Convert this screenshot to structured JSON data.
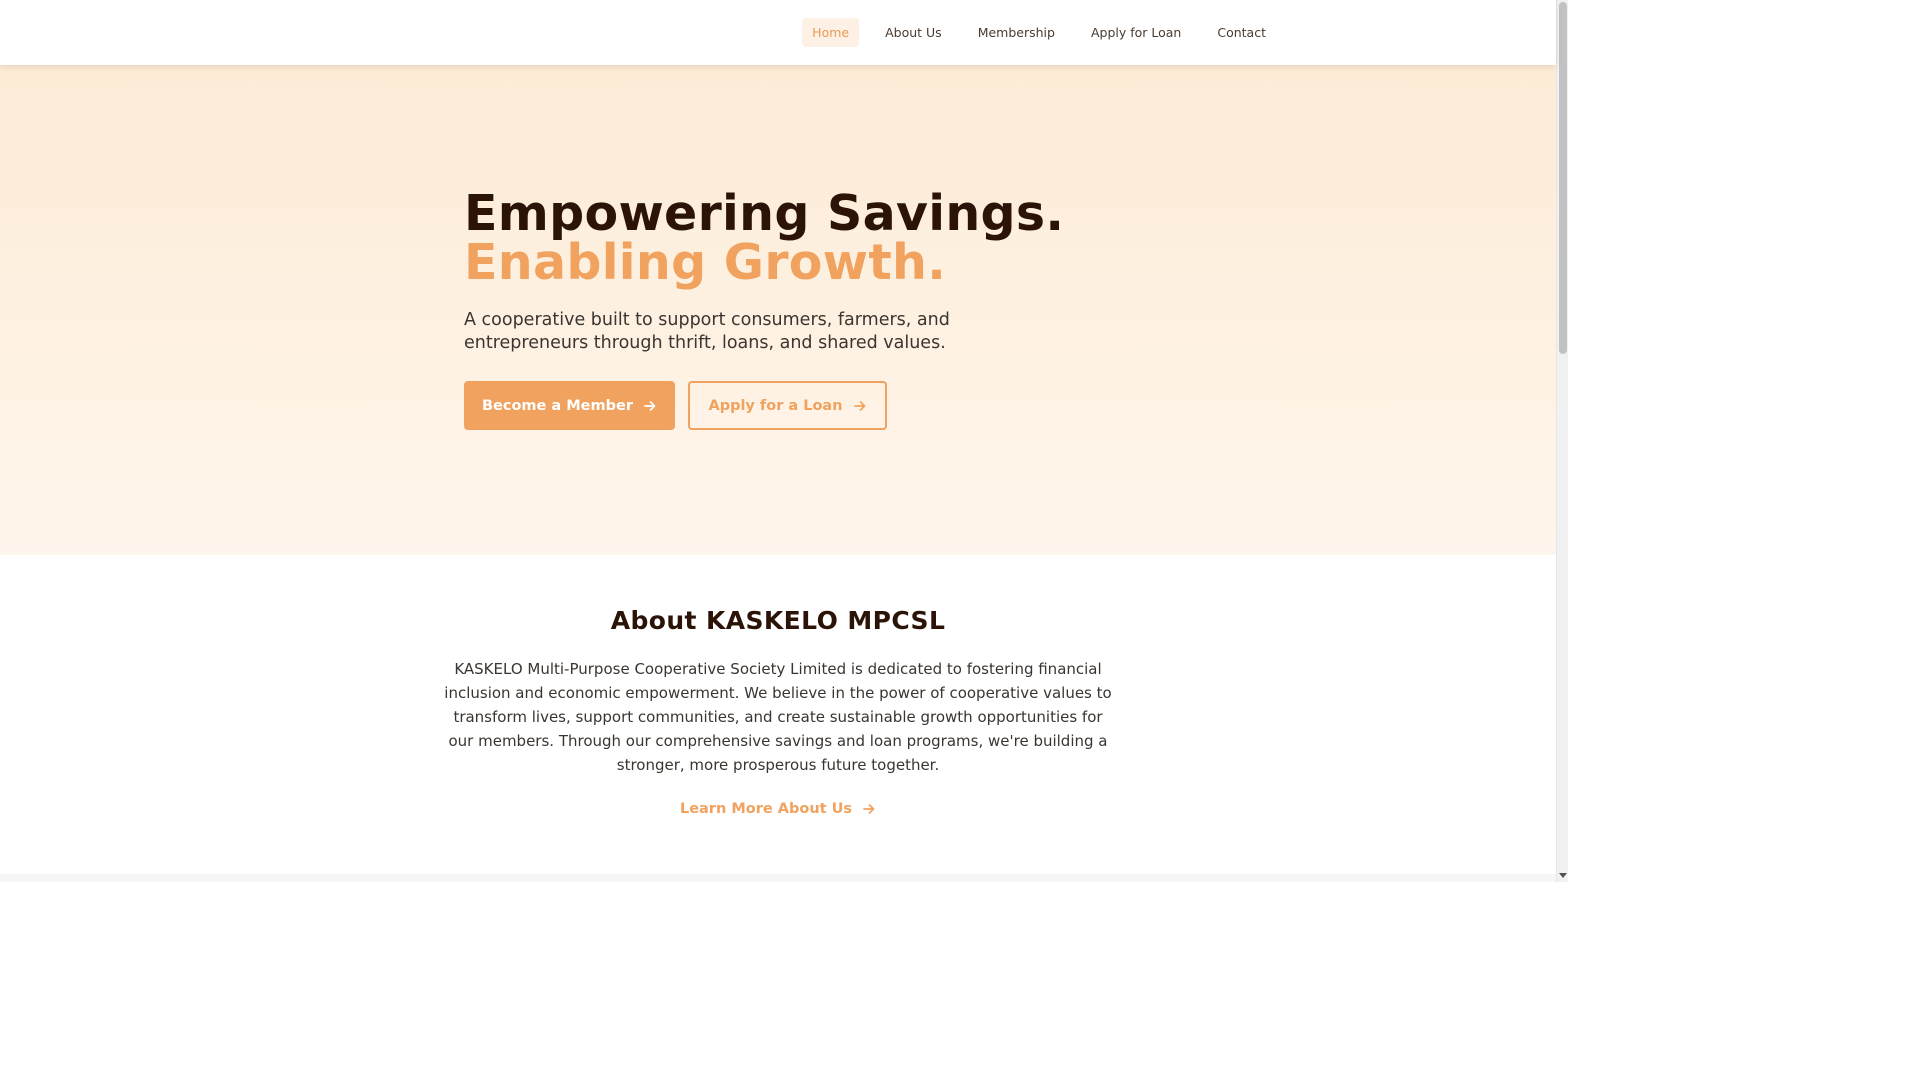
{
  "nav": {
    "items": [
      {
        "label": "Home",
        "active": true
      },
      {
        "label": "About Us"
      },
      {
        "label": "Membership"
      },
      {
        "label": "Apply for Loan"
      },
      {
        "label": "Contact"
      }
    ]
  },
  "hero": {
    "title_line1": "Empowering Savings.",
    "title_line2": "Enabling Growth.",
    "subtitle": "A cooperative built to support consumers, farmers, and entrepreneurs through thrift, loans, and shared values.",
    "primary_button": "Become a Member",
    "secondary_button": "Apply for a Loan",
    "button_icon": "arrow-right-icon"
  },
  "about": {
    "title": "About KASKELO MPCSL",
    "text": "KASKELO Multi-Purpose Cooperative Society Limited is dedicated to fostering financial inclusion and economic empowerment. We believe in the power of cooperative values to transform lives, support communities, and create sustainable growth opportunities for our members. Through our comprehensive savings and loan programs, we're building a stronger, more prosperous future together.",
    "link": "Learn More About Us"
  },
  "colors": {
    "accent": "#f0a25e",
    "heading": "#2b1407",
    "hero_bg_top": "#fdebd6",
    "hero_bg_bottom": "#fef6ec"
  }
}
